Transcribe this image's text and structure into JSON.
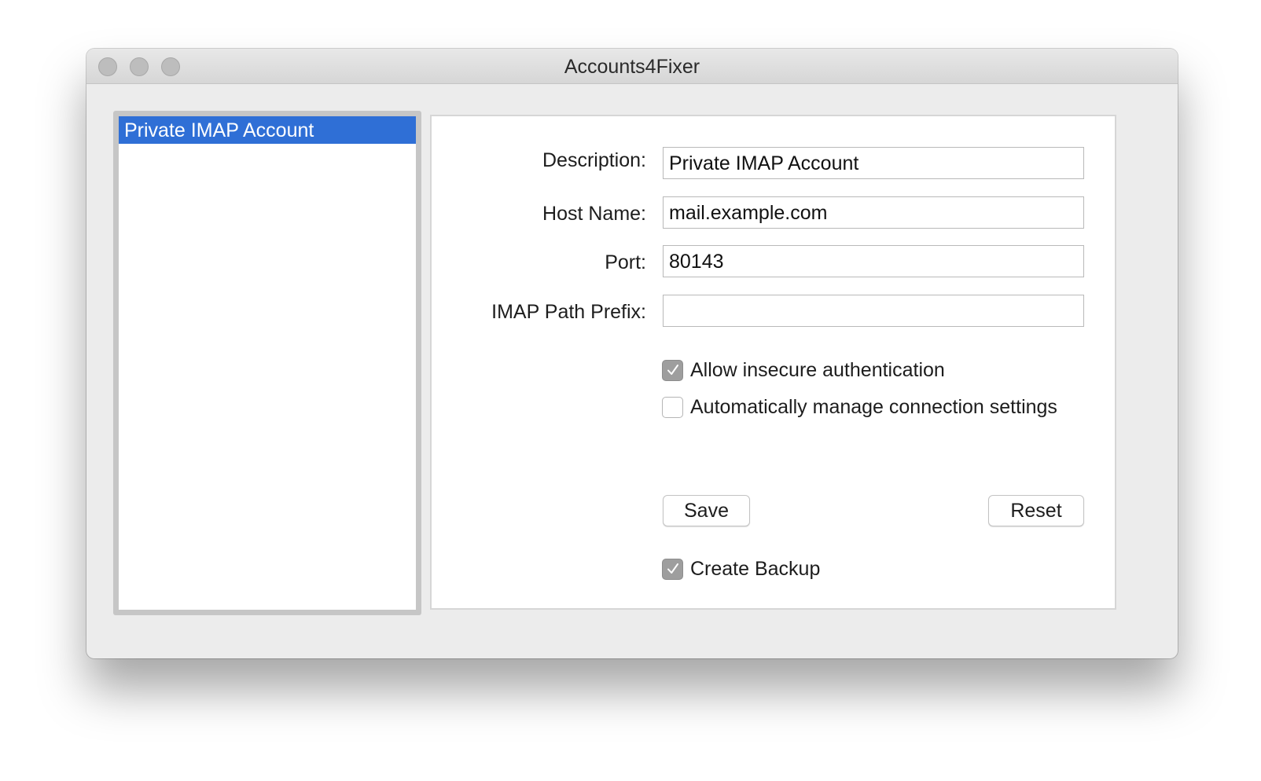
{
  "window": {
    "title": "Accounts4Fixer"
  },
  "sidebar": {
    "items": [
      {
        "label": "Private IMAP Account",
        "selected": true
      }
    ]
  },
  "form": {
    "description_label": "Description:",
    "description_value": "Private IMAP Account",
    "host_label": "Host Name:",
    "host_value": "mail.example.com",
    "port_label": "Port:",
    "port_value": "80143",
    "prefix_label": "IMAP Path Prefix:",
    "prefix_value": "",
    "allow_insecure_label": "Allow insecure authentication",
    "allow_insecure_checked": true,
    "auto_manage_label": "Automatically manage connection settings",
    "auto_manage_checked": false,
    "save_label": "Save",
    "reset_label": "Reset",
    "create_backup_label": "Create Backup",
    "create_backup_checked": true
  },
  "colors": {
    "selection": "#2f6fd6",
    "window_background": "#ececec",
    "checkbox_checked": "#9e9e9e"
  },
  "icons": {
    "close": "close-button-icon",
    "minimize": "minimize-button-icon",
    "zoom": "zoom-button-icon",
    "check": "checkmark-icon"
  }
}
